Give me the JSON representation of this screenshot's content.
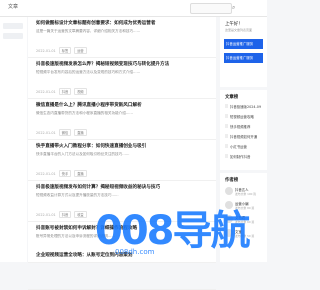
{
  "header": {
    "brand": "文章"
  },
  "articles": [
    {
      "title": "如何做图标设计文章标题有创意要求：如何成为优秀运营者",
      "snippet": "这是一篇关于运营的文章摘要内容，详细介绍相关方法和技巧……",
      "meta": "2022-01-01",
      "tags": [
        "标签",
        "运营"
      ]
    },
    {
      "title": "抖音极速版视频发表怎么弄？揭秘短视频变现技巧与转化提升方法",
      "snippet": "短视频平台发布内容后的运营方法以及变现的技巧和方式介绍……",
      "meta": "2022-01-01",
      "tags": [
        "抖音",
        "视频"
      ]
    },
    {
      "title": "微信直播是什么上？腾讯直播小程序带货新风口解析",
      "snippet": "微信生态内直播带货的方法和小程序直播的相关功能介绍……",
      "meta": "2022-01-01",
      "tags": [
        "微信",
        "直播"
      ]
    },
    {
      "title": "快手直播带火入门教程分享：如何快速直播创业与吸引",
      "snippet": "快手直播平台的入门方法以及如何吸引粉丝关注的技巧……",
      "meta": "2022-01-01",
      "tags": [
        "快手",
        "直播"
      ]
    },
    {
      "title": "抖音极速版视频发布如何计算？揭秘短视频收益的秘诀与技巧",
      "snippet": "短视频收益计算方式以及提升播放量的方法技巧……",
      "meta": "2022-01-01",
      "tags": [
        "抖音",
        "收益"
      ]
    },
    {
      "title": "抖音账号被封禁如何申诉解封？详细操作流程攻略",
      "snippet": "账号异常处理的方法以及申诉流程的详细说明……",
      "meta": "2022-01-01",
      "tags": [
        "抖音",
        "账号"
      ]
    },
    {
      "title": "企业短视频运营全攻略：从账号定位到内容策划",
      "snippet": "",
      "meta": "",
      "tags": []
    }
  ],
  "sidebar": {
    "welcome_title": "上午好！",
    "welcome_sub": "这里是文章列表页面",
    "ad_text": "抖音运营推广服务",
    "recommend_title": "文章榜",
    "recommend_items": [
      "抖音极速版2024-09",
      "短视频运营攻略",
      "快手视频推荐",
      "抖音视频如何开通",
      "小红书运营",
      "如何制作抖音"
    ],
    "authors_title": "作者榜",
    "authors": [
      {
        "name": "抖音达人",
        "sub": "发布文章 100 篇"
      },
      {
        "name": "运营小编",
        "sub": "发布文章 80 篇"
      },
      {
        "name": "文档君",
        "sub": "发布文章 60 篇"
      },
      {
        "name": "文宝",
        "sub": "发布文章 50 篇"
      }
    ]
  },
  "watermark": {
    "text": "008导航",
    "url": "008dh.com"
  },
  "colors": {
    "accent": "#1e63e9",
    "watermark": "#1679ff"
  }
}
